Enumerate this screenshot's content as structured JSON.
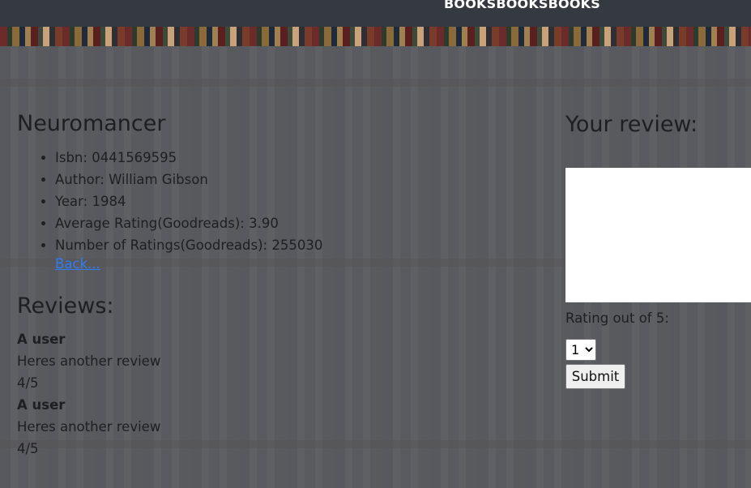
{
  "navbar": {
    "brand": "BOOKSBOOKSBOOKS"
  },
  "book": {
    "title": "Neuromancer",
    "details": [
      "Isbn: 0441569595",
      "Author: William Gibson",
      "Year: 1984",
      "Average Rating(Goodreads): 3.90",
      "Number of Ratings(Goodreads): 255030"
    ],
    "back_label": "Back..."
  },
  "reviews": {
    "heading": "Reviews:",
    "items": [
      {
        "user": "A user",
        "text": "Heres another review",
        "rating": "4/5"
      },
      {
        "user": "A user",
        "text": "Heres another review",
        "rating": "4/5"
      }
    ]
  },
  "review_form": {
    "heading": "Your review:",
    "textarea_value": "",
    "rating_label": "Rating out of 5:",
    "rating_selected": "1",
    "submit_label": "Submit"
  }
}
